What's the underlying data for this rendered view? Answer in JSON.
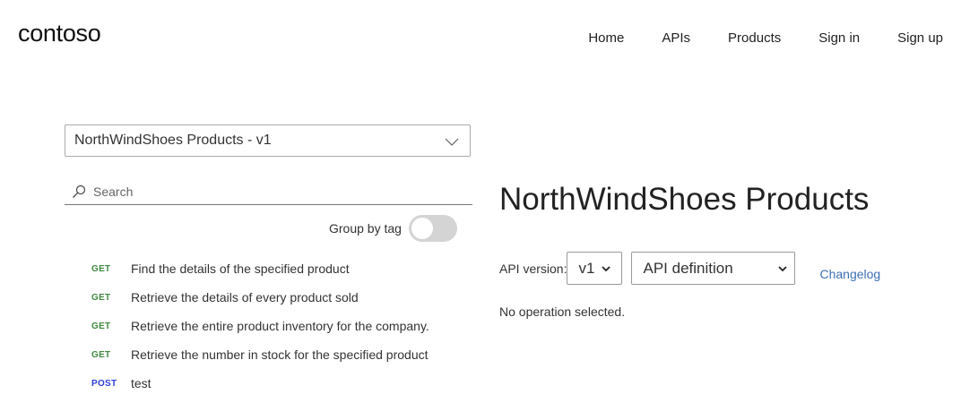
{
  "header": {
    "logo": "contoso",
    "nav": [
      "Home",
      "APIs",
      "Products",
      "Sign in",
      "Sign up"
    ]
  },
  "sidebar": {
    "api_select": "NorthWindShoes Products - v1",
    "search_placeholder": "Search",
    "group_by_label": "Group by tag",
    "group_by_on": false,
    "operations": [
      {
        "method": "GET",
        "name": "Find the details of the specified product"
      },
      {
        "method": "GET",
        "name": "Retrieve the details of every product sold"
      },
      {
        "method": "GET",
        "name": "Retrieve the entire product inventory for the company."
      },
      {
        "method": "GET",
        "name": "Retrieve the number in stock for the specified product"
      },
      {
        "method": "POST",
        "name": "test"
      }
    ]
  },
  "main": {
    "title": "NorthWindShoes Products",
    "version_label": "API version:",
    "version_value": "v1",
    "definition_value": "API definition",
    "changelog": "Changelog",
    "status": "No operation selected."
  },
  "colors": {
    "get": "#3e8a3e",
    "post": "#2b3fd0",
    "link": "#3e6fb5"
  }
}
